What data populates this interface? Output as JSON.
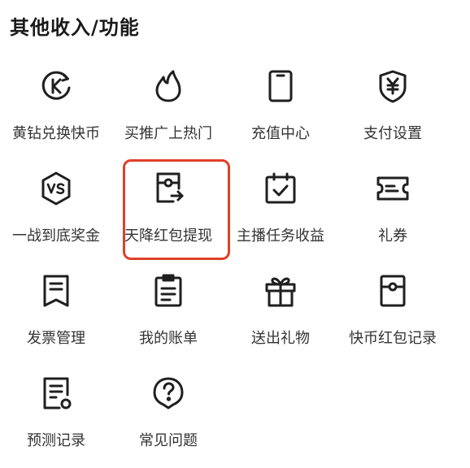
{
  "section": {
    "title": "其他收入/功能"
  },
  "items": [
    {
      "label": "黄钻兑换快币",
      "icon": "coin-exchange-icon"
    },
    {
      "label": "买推广上热门",
      "icon": "flame-icon"
    },
    {
      "label": "充值中心",
      "icon": "phone-icon"
    },
    {
      "label": "支付设置",
      "icon": "yuan-shield-icon"
    },
    {
      "label": "一战到底奖金",
      "icon": "vs-badge-icon"
    },
    {
      "label": "天降红包提现",
      "icon": "red-packet-withdraw-icon"
    },
    {
      "label": "主播任务收益",
      "icon": "calendar-check-icon"
    },
    {
      "label": "礼券",
      "icon": "ticket-icon"
    },
    {
      "label": "发票管理",
      "icon": "invoice-icon"
    },
    {
      "label": "我的账单",
      "icon": "bill-icon"
    },
    {
      "label": "送出礼物",
      "icon": "gift-icon"
    },
    {
      "label": "快币红包记录",
      "icon": "red-packet-record-icon"
    },
    {
      "label": "预测记录",
      "icon": "prediction-record-icon"
    },
    {
      "label": "常见问题",
      "icon": "question-icon"
    }
  ],
  "highlight": {
    "item": "天降红包提现",
    "color": "#e0402a"
  },
  "colors": {
    "icon_stroke": "#1f1f1f",
    "text": "#333333",
    "background": "#ffffff"
  }
}
